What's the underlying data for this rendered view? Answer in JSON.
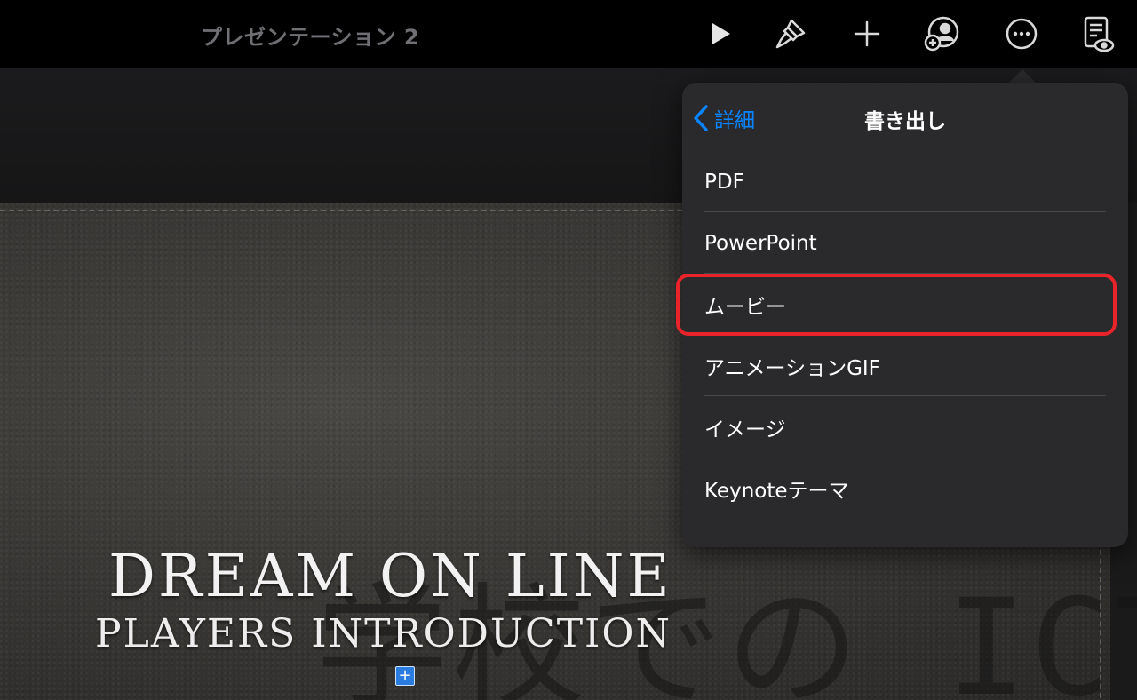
{
  "toolbar": {
    "document_title": "プレゼンテーション 2",
    "icons": [
      "play-icon",
      "format-brush-icon",
      "add-icon",
      "collaborate-icon",
      "more-icon",
      "reader-view-icon"
    ]
  },
  "slide": {
    "title": "DREAM ON LINE",
    "subtitle": "PLAYERS INTRODUCTION",
    "watermark_text": "学校での ICT",
    "add_handle_label": "+"
  },
  "popover": {
    "back_label": "詳細",
    "title": "書き出し",
    "items": [
      {
        "label": "PDF"
      },
      {
        "label": "PowerPoint"
      },
      {
        "label": "ムービー",
        "highlighted": true
      },
      {
        "label": "アニメーションGIF"
      },
      {
        "label": "イメージ"
      },
      {
        "label": "Keynoteテーマ"
      }
    ],
    "highlight_color": "#e8242a"
  },
  "colors": {
    "accent": "#0a84ff",
    "popover_bg": "#2a2a2c",
    "toolbar_bg": "#000000"
  }
}
